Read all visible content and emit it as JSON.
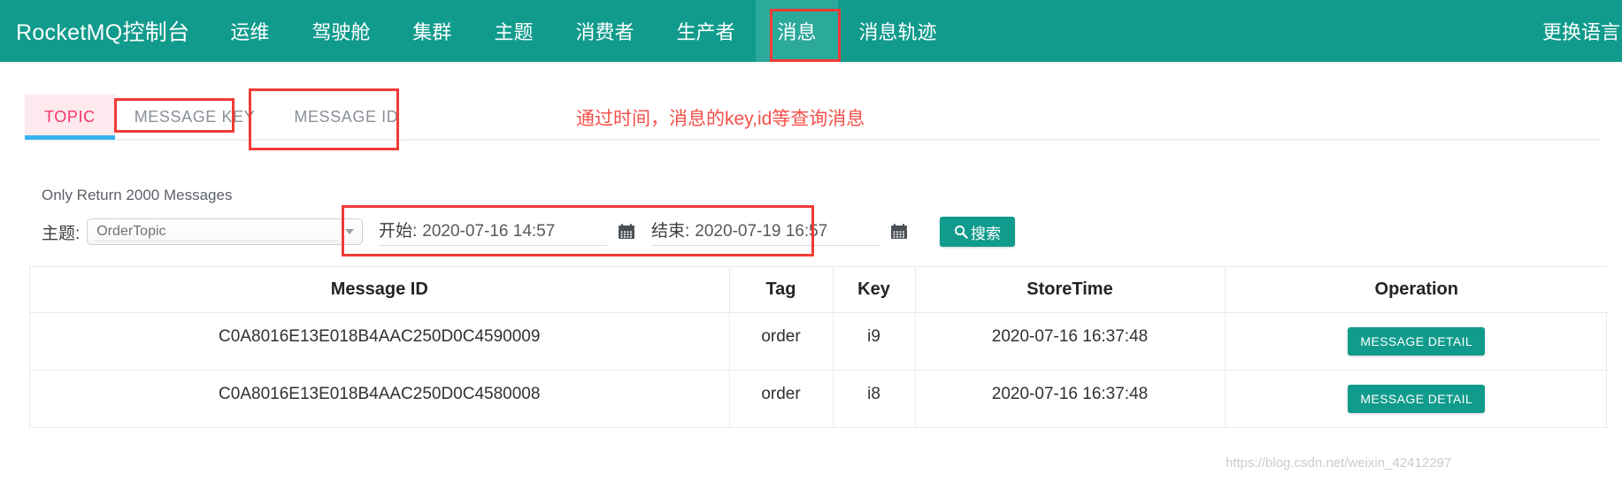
{
  "navbar": {
    "brand": "RocketMQ控制台",
    "items": [
      {
        "label": "运维",
        "active": false
      },
      {
        "label": "驾驶舱",
        "active": false
      },
      {
        "label": "集群",
        "active": false
      },
      {
        "label": "主题",
        "active": false
      },
      {
        "label": "消费者",
        "active": false
      },
      {
        "label": "生产者",
        "active": false
      },
      {
        "label": "消息",
        "active": true
      },
      {
        "label": "消息轨迹",
        "active": false
      }
    ],
    "language_switch": "更换语言",
    "background_color": "#119b8c",
    "active_background_color": "#2ba99a"
  },
  "tabs": [
    {
      "label": "TOPIC",
      "active": true
    },
    {
      "label": "MESSAGE KEY",
      "active": false
    },
    {
      "label": "MESSAGE ID",
      "active": false
    }
  ],
  "annotation": {
    "note_text": "通过时间，消息的key,id等查询消息",
    "color": "#f23b36"
  },
  "info": {
    "only_return": "Only Return 2000 Messages"
  },
  "search_form": {
    "topic_label": "主题:",
    "topic_value": "OrderTopic",
    "topic_placeholder": "OrderTopic",
    "begin_label": "开始:",
    "begin_value": "2020-07-16 14:57",
    "end_label": "结束:",
    "end_value": "2020-07-19 16:57",
    "search_button": "搜索",
    "search_icon": "search-icon",
    "calendar_icon": "calendar-icon",
    "accent_color": "#119b8c"
  },
  "table": {
    "headers": [
      "Message ID",
      "Tag",
      "Key",
      "StoreTime",
      "Operation"
    ],
    "rows": [
      {
        "message_id": "C0A8016E13E018B4AAC250D0C4590009",
        "tag": "order",
        "key": "i9",
        "store_time": "2020-07-16 16:37:48",
        "operation": "MESSAGE DETAIL"
      },
      {
        "message_id": "C0A8016E13E018B4AAC250D0C4580008",
        "tag": "order",
        "key": "i8",
        "store_time": "2020-07-16 16:37:48",
        "operation": "MESSAGE DETAIL"
      }
    ]
  },
  "watermark": "https://blog.csdn.net/weixin_42412297"
}
